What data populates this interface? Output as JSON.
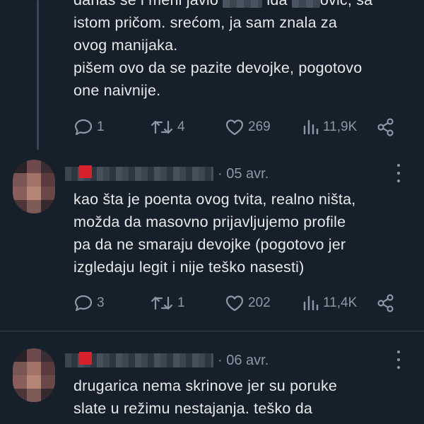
{
  "tweets": [
    {
      "text_lines": [
        "danas se i meni javio",
        "ida",
        "ović, sa",
        "istom pričom. srećom, ja sam znala za",
        "ovog manijaka.",
        "pišem ovo da se pazite devojke, pogotovo",
        "one naivnije."
      ],
      "stats": {
        "replies": "1",
        "retweets": "4",
        "likes": "269",
        "views": "11,9K"
      }
    },
    {
      "date": "· 05 avr.",
      "text_lines": [
        "kao šta je poenta ovog tvita, realno ništa,",
        "možda da masovno prijavljujemo profile",
        "pa da ne smaraju devojke (pogotovo jer",
        "izgledaju legit i nije teško nasesti)"
      ],
      "stats": {
        "replies": "3",
        "retweets": "1",
        "likes": "202",
        "views": "11,4K"
      }
    },
    {
      "date": "· 06 avr.",
      "text_lines": [
        "drugarica nema skrinove jer su poruke",
        "slate u režimu nestajanja. teško da"
      ]
    }
  ],
  "icons": {
    "reply": "reply-icon",
    "retweet": "retweet-icon",
    "like": "heart-icon",
    "views": "views-icon",
    "share": "share-icon",
    "more": "more-icon"
  },
  "colors": {
    "background": "#15202b",
    "text": "#e7e9ea",
    "secondary": "#8b98a5",
    "divider": "#2f3b47"
  }
}
